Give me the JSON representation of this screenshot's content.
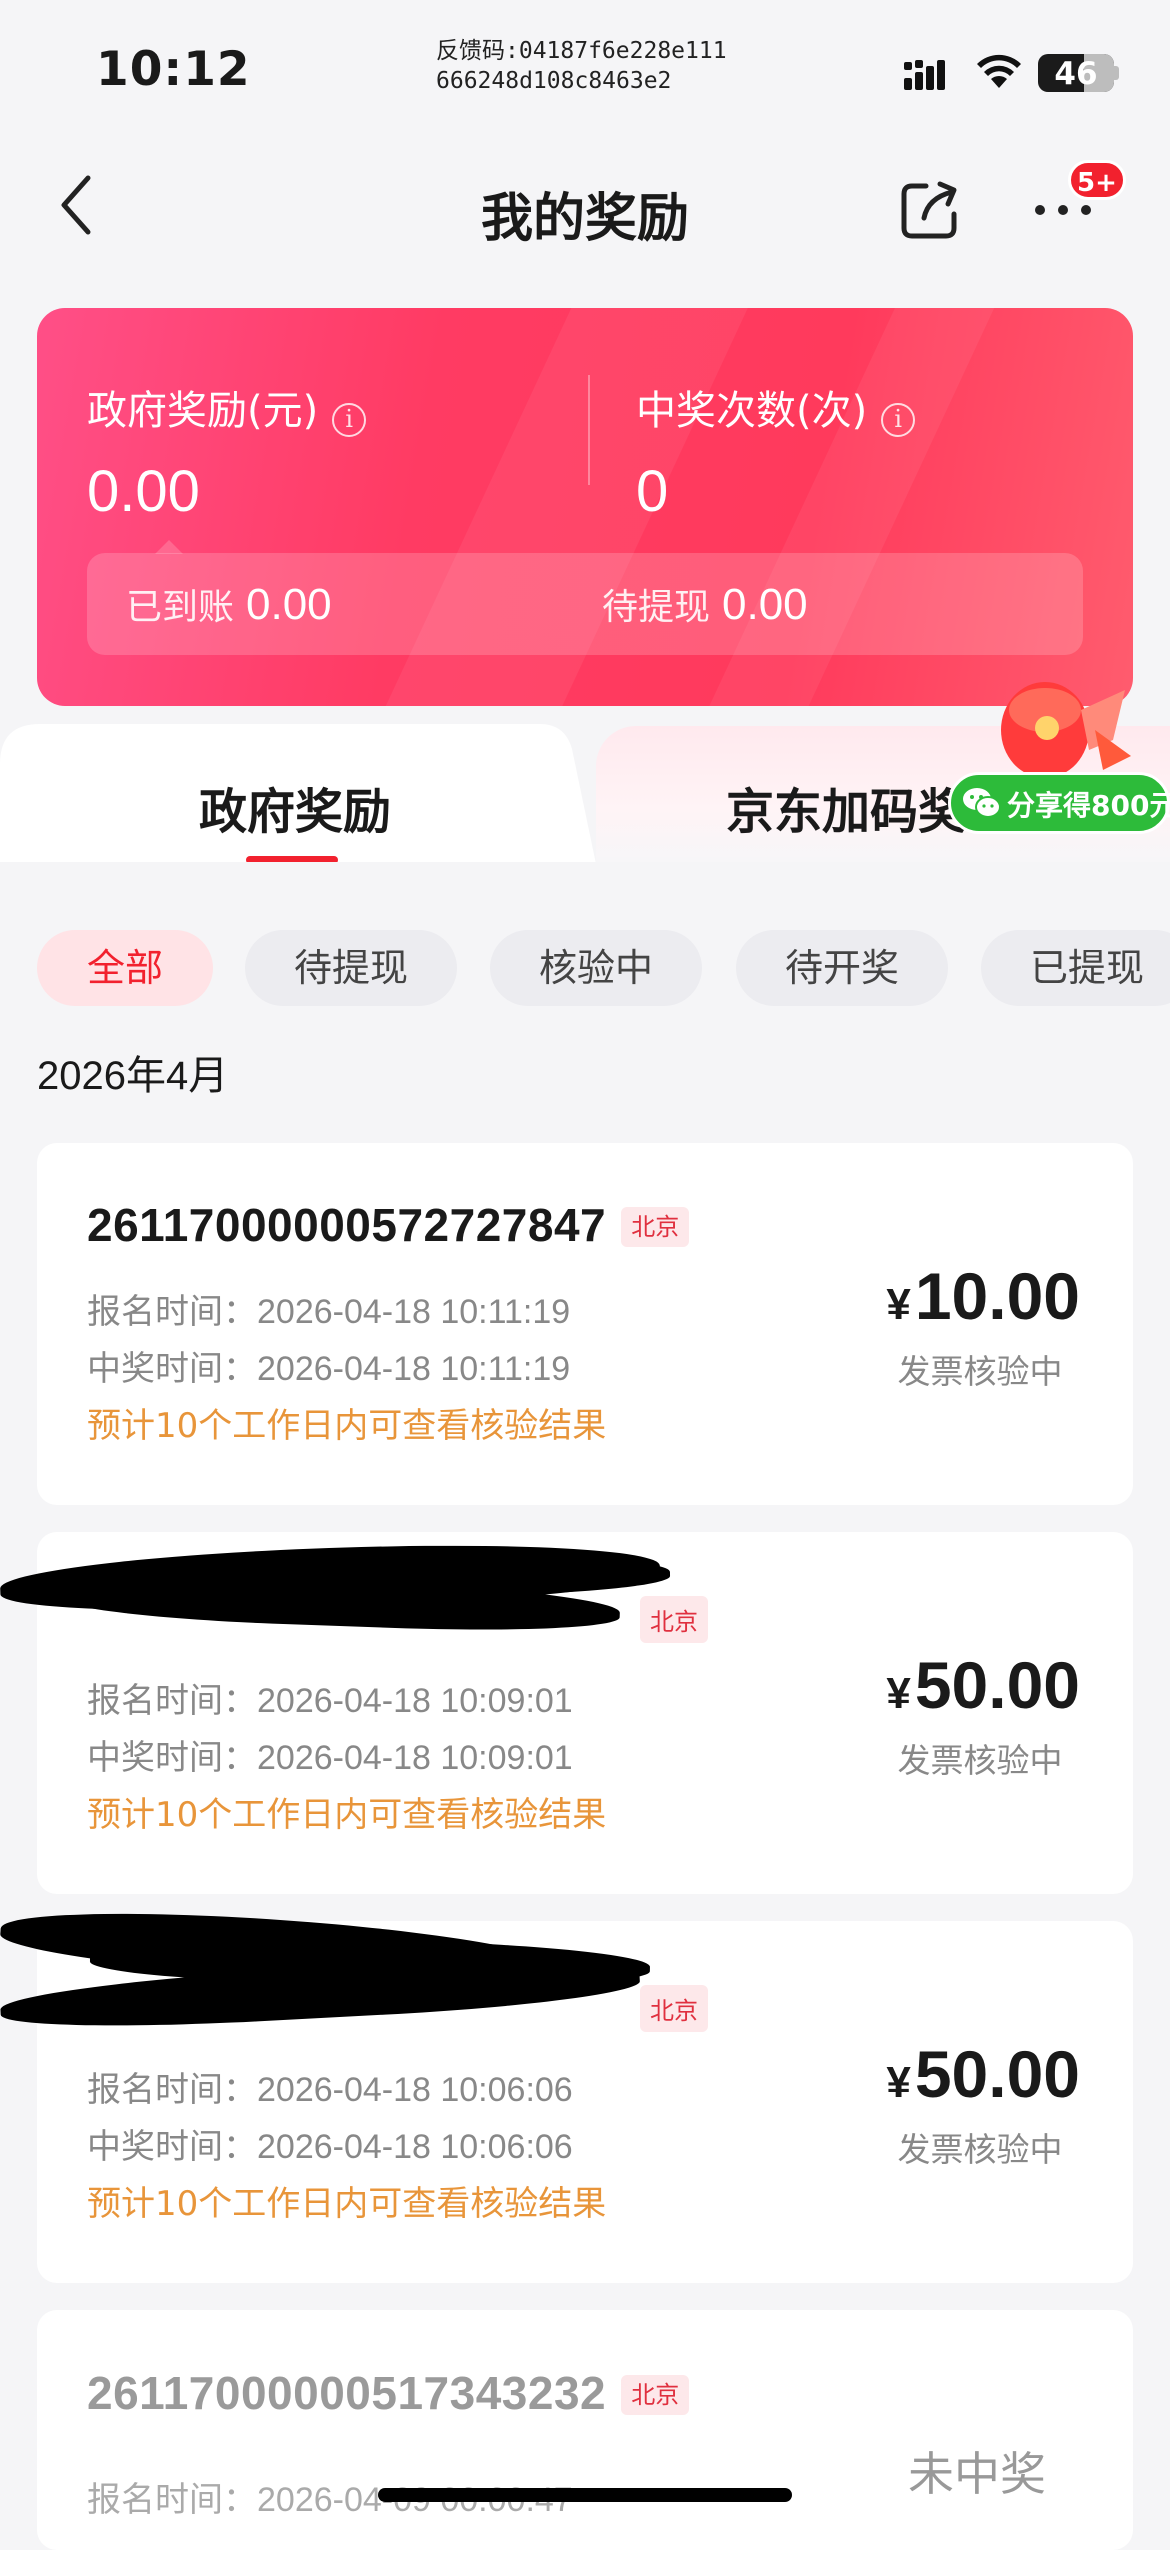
{
  "status_bar": {
    "time": "10:12",
    "feedback_line1": "反馈码:04187f6e228e111",
    "feedback_line2": "666248d108c8463e2",
    "battery": "46"
  },
  "nav": {
    "title": "我的奖励",
    "more_badge": "5+"
  },
  "summary": {
    "gov_reward_label": "政府奖励(元)",
    "gov_reward_value": "0.00",
    "win_count_label": "中奖次数(次)",
    "win_count_value": "0",
    "received_label": "已到账",
    "received_value": "0.00",
    "pending_label": "待提现",
    "pending_value": "0.00",
    "info_glyph": "i"
  },
  "tabs": {
    "left": "政府奖励",
    "right": "京东加码奖"
  },
  "promo": {
    "label": "分享得800元"
  },
  "filters": [
    "全部",
    "待提现",
    "核验中",
    "待开奖",
    "已提现"
  ],
  "month": "2026年4月",
  "records": [
    {
      "order_no": "261170000005727278​47",
      "region": "北京",
      "signup_label": "报名时间：",
      "signup_time": "2026-04-18 10:11:19",
      "win_label": "中奖时间：",
      "win_time": "2026-04-18 10:11:19",
      "note": "预计10个工作日内可查看核验结果",
      "currency": "¥",
      "amount": "10.00",
      "status": "发票核验中"
    },
    {
      "order_no": "",
      "region": "北京",
      "signup_label": "报名时间：",
      "signup_time": "2026-04-18 10:09:01",
      "win_label": "中奖时间：",
      "win_time": "2026-04-18 10:09:01",
      "note": "预计10个工作日内可查看核验结果",
      "currency": "¥",
      "amount": "50.00",
      "status": "发票核验中"
    },
    {
      "order_no": "",
      "region": "北京",
      "signup_label": "报名时间：",
      "signup_time": "2026-04-18 10:06:06",
      "win_label": "中奖时间：",
      "win_time": "2026-04-18 10:06:06",
      "note": "预计10个工作日内可查看核验结果",
      "currency": "¥",
      "amount": "50.00",
      "status": "发票核验中"
    },
    {
      "order_no": "261170000005173432​32",
      "region": "北京",
      "signup_label": "报名时间：",
      "signup_time": "2026-04-09 00:00:47",
      "status": "未中奖"
    }
  ]
}
